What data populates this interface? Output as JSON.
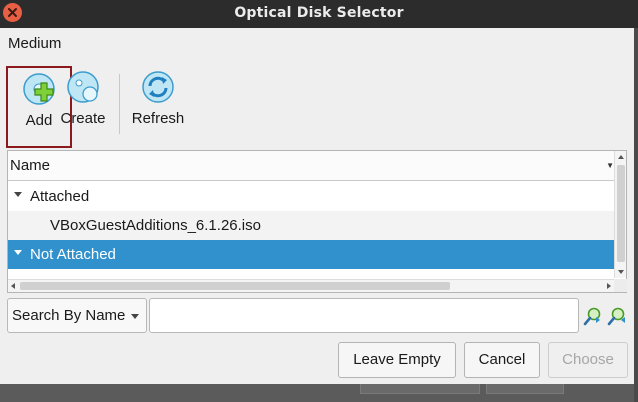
{
  "window": {
    "title": "Optical Disk Selector"
  },
  "menubar": {
    "items": [
      {
        "label": "Medium"
      }
    ]
  },
  "toolbar": {
    "add_label": "Add",
    "create_label": "Create",
    "refresh_label": "Refresh"
  },
  "tree": {
    "column_header": "Name",
    "groups": [
      {
        "label": "Attached",
        "expanded": true,
        "items": [
          {
            "label": "VBoxGuestAdditions_6.1.26.iso"
          }
        ]
      },
      {
        "label": "Not Attached",
        "expanded": true,
        "selected": true,
        "items": []
      }
    ]
  },
  "search": {
    "mode": "Search By Name",
    "value": "",
    "placeholder": ""
  },
  "buttons": {
    "leave_empty": "Leave Empty",
    "cancel": "Cancel",
    "choose": "Choose",
    "choose_enabled": false
  },
  "colors": {
    "selection": "#3091cc",
    "titlebar": "#2c2c2c",
    "close": "#e95f44",
    "highlight_frame": "#8b1a1f"
  },
  "icons": {
    "close": "close-icon",
    "add": "add-disk-icon",
    "create": "create-disk-icon",
    "refresh": "refresh-icon",
    "search_prev": "search-previous-icon",
    "search_next": "search-next-icon"
  }
}
